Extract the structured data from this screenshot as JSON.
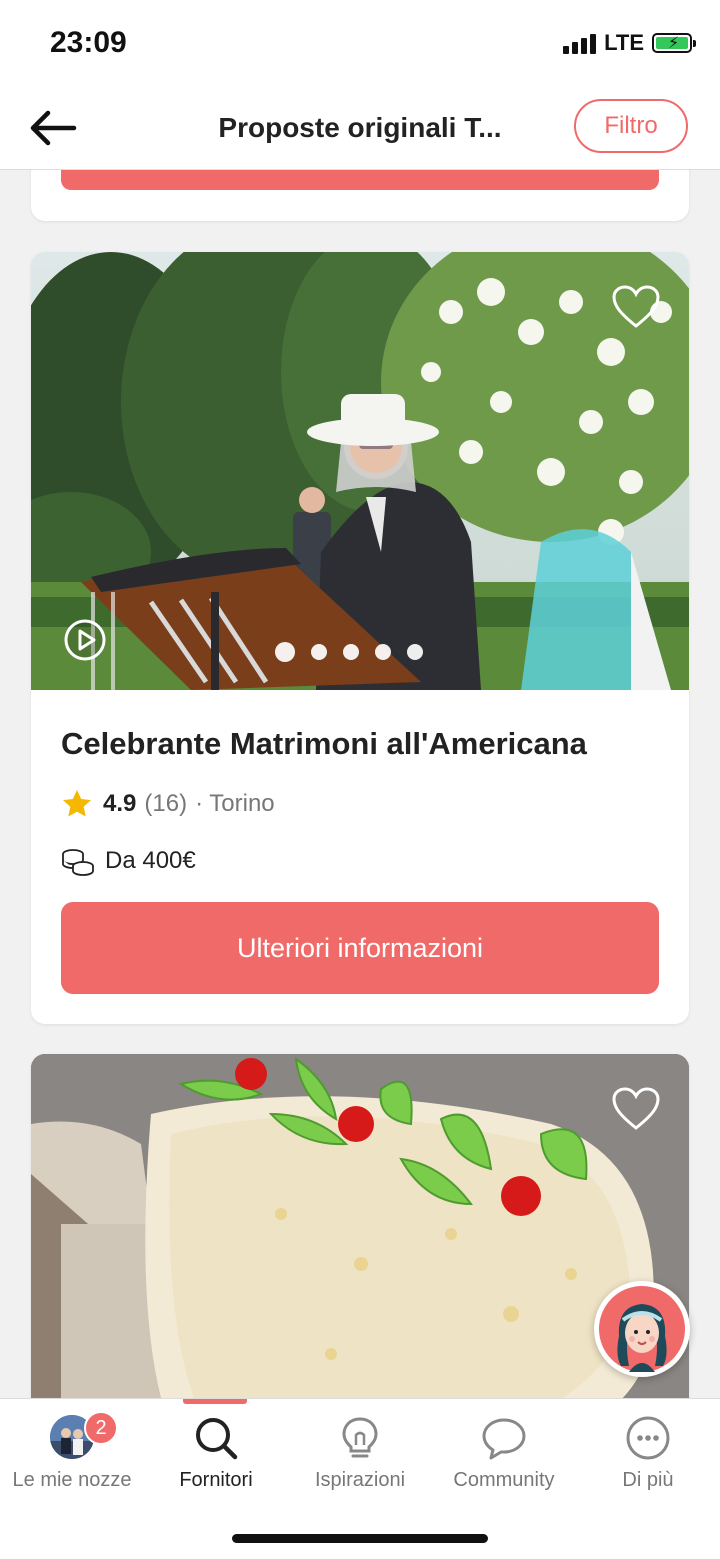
{
  "status_bar": {
    "time": "23:09",
    "network": "LTE"
  },
  "header": {
    "title": "Proposte originali T...",
    "filter_label": "Filtro"
  },
  "listing": {
    "name": "Celebrante Matrimoni all'Americana",
    "rating": "4.9",
    "reviews": "(16)",
    "location": "· Torino",
    "price": "Da 400€",
    "cta_label": "Ulteriori informazioni",
    "photo_dots": 5,
    "active_photo_index": 0
  },
  "tabbar": {
    "items": [
      {
        "label": "Le mie nozze",
        "badge": "2",
        "icon": "avatar"
      },
      {
        "label": "Fornitori",
        "icon": "search-icon",
        "active": true
      },
      {
        "label": "Ispirazioni",
        "icon": "lightbulb-icon"
      },
      {
        "label": "Community",
        "icon": "chat-bubble-icon"
      },
      {
        "label": "Di più",
        "icon": "more-icon"
      }
    ]
  },
  "colors": {
    "accent": "#f06a6a",
    "star": "#f5b800",
    "battery": "#34c759"
  }
}
